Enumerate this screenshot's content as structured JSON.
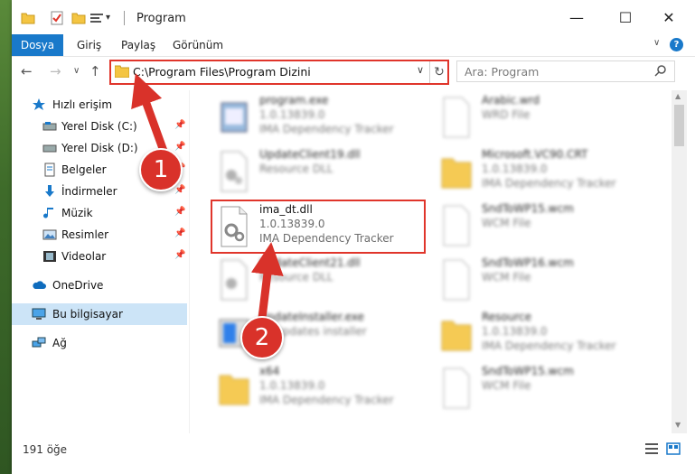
{
  "window": {
    "title": "Program"
  },
  "ribbon": {
    "tabs": [
      "Dosya",
      "Giriş",
      "Paylaş",
      "Görünüm"
    ]
  },
  "address": {
    "path": "C:\\Program Files\\Program Dizini"
  },
  "search": {
    "placeholder": "Ara: Program"
  },
  "sidebar": {
    "items": [
      {
        "label": "Hızlı erişim",
        "icon": "star-icon"
      },
      {
        "label": "Yerel Disk (C:)",
        "icon": "drive-icon",
        "pinned": true
      },
      {
        "label": "Yerel Disk (D:)",
        "icon": "drive-icon",
        "pinned": true
      },
      {
        "label": "Belgeler",
        "icon": "documents-icon",
        "pinned": true
      },
      {
        "label": "İndirmeler",
        "icon": "download-icon",
        "pinned": true
      },
      {
        "label": "Müzik",
        "icon": "music-icon",
        "pinned": true
      },
      {
        "label": "Resimler",
        "icon": "pictures-icon",
        "pinned": true
      },
      {
        "label": "Videolar",
        "icon": "video-icon",
        "pinned": true
      },
      {
        "label": "OneDrive",
        "icon": "cloud-icon"
      },
      {
        "label": "Bu bilgisayar",
        "icon": "computer-icon",
        "selected": true
      },
      {
        "label": "Ağ",
        "icon": "network-icon"
      }
    ]
  },
  "files": {
    "left": [
      {
        "name": "program.exe",
        "line1": "1.0.13839.0",
        "line2": "IMA Dependency Tracker",
        "icon": "exe-icon"
      },
      {
        "name": "UpdateClient19.dll",
        "line1": "Resource DLL",
        "line2": "",
        "icon": "dll-icon"
      },
      {
        "name": "ima_dt.dll",
        "line1": "1.0.13839.0",
        "line2": "IMA Dependency Tracker",
        "icon": "dll-icon",
        "highlighted": true
      },
      {
        "name": "UpdateClient21.dll",
        "line1": "Resource DLL",
        "line2": "",
        "icon": "dll-icon"
      },
      {
        "name": "UpdateInstaller.exe",
        "line1": "FY updates installer",
        "line2": "",
        "icon": "installer-icon"
      },
      {
        "name": "x64",
        "line1": "1.0.13839.0",
        "line2": "IMA Dependency Tracker",
        "icon": "folder-icon"
      }
    ],
    "right": [
      {
        "name": "Arabic.wrd",
        "line1": "WRD File",
        "line2": "",
        "icon": "blank-file-icon"
      },
      {
        "name": "Microsoft.VC90.CRT",
        "line1": "1.0.13839.0",
        "line2": "IMA Dependency Tracker",
        "icon": "folder-icon"
      },
      {
        "name": "SndToWP15.wcm",
        "line1": "WCM File",
        "line2": "",
        "icon": "blank-file-icon"
      },
      {
        "name": "SndToWP16.wcm",
        "line1": "WCM File",
        "line2": "",
        "icon": "blank-file-icon"
      },
      {
        "name": "Resource",
        "line1": "1.0.13839.0",
        "line2": "IMA Dependency Tracker",
        "icon": "folder-icon"
      },
      {
        "name": "SndToWP15.wcm",
        "line1": "WCM File",
        "line2": "",
        "icon": "blank-file-icon"
      }
    ]
  },
  "status": {
    "count": "191 öğe"
  },
  "callouts": {
    "one": "1",
    "two": "2"
  },
  "colors": {
    "accent": "#1979ca",
    "highlight": "#e0352b",
    "selected": "#cce4f7"
  }
}
